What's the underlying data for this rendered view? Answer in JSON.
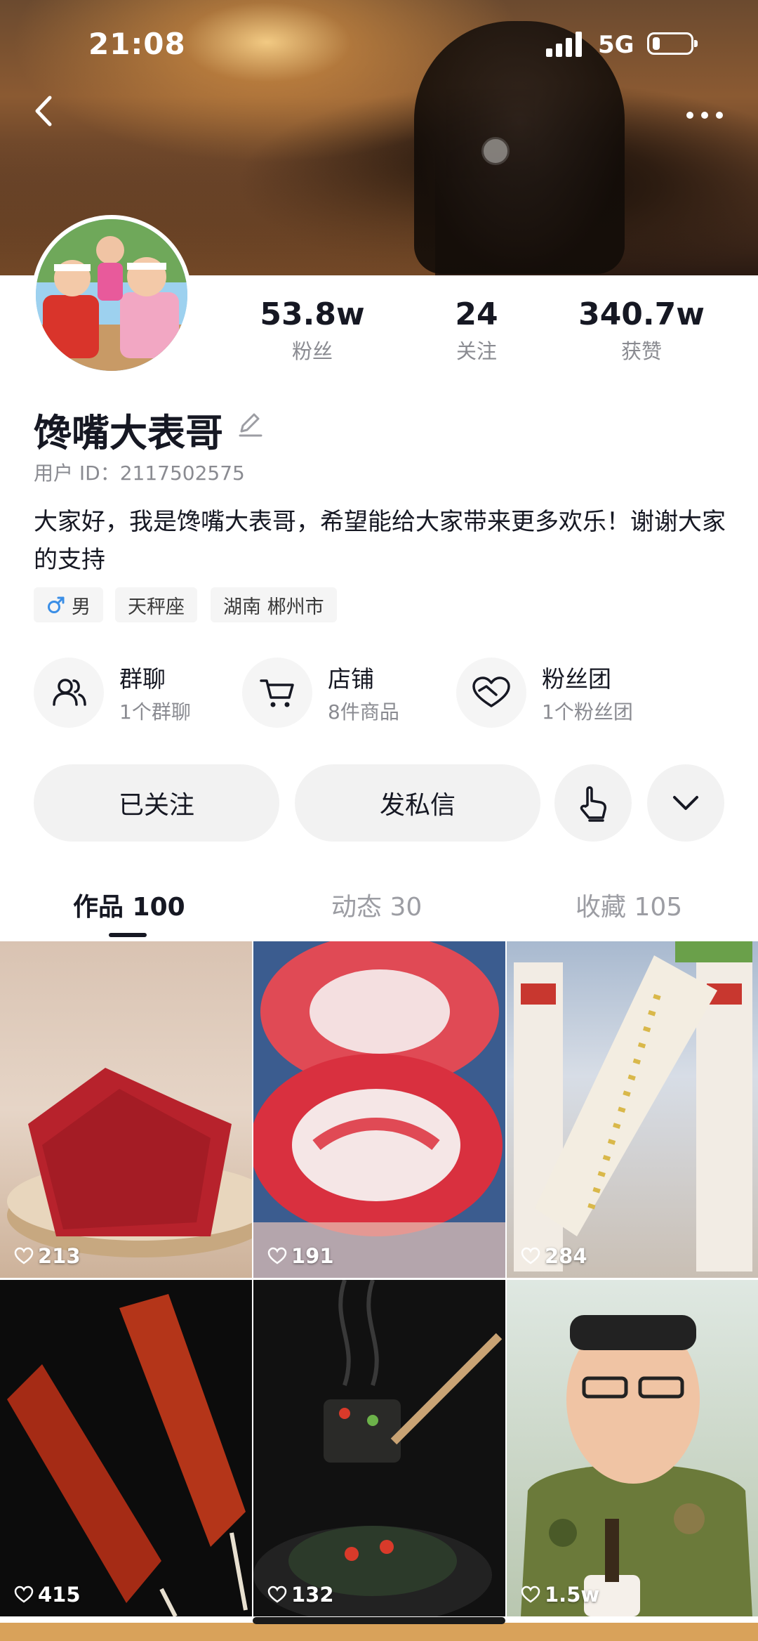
{
  "status_bar": {
    "time": "21:08",
    "network": "5G",
    "battery_level": 0.2
  },
  "header": {
    "back_icon": "chevron-left-icon",
    "more_icon": "more-horizontal-icon"
  },
  "profile": {
    "name": "馋嘴大表哥",
    "user_id": "用户 ID：2117502575",
    "bio": "大家好，我是馋嘴大表哥，希望能给大家带来更多欢乐！谢谢大家的支持",
    "stats": [
      {
        "value": "53.8w",
        "label": "粉丝"
      },
      {
        "value": "24",
        "label": "关注"
      },
      {
        "value": "340.7w",
        "label": "获赞"
      }
    ],
    "tags": [
      {
        "icon": "male-icon",
        "label": "男",
        "color": "#3a8ee6"
      },
      {
        "label": "天秤座"
      },
      {
        "label": "湖南 郴州市"
      }
    ]
  },
  "services": [
    {
      "icon": "group-chat-icon",
      "title": "群聊",
      "subtitle": "1个群聊"
    },
    {
      "icon": "shopping-cart-icon",
      "title": "店铺",
      "subtitle": "8件商品"
    },
    {
      "icon": "fan-club-heart-icon",
      "title": "粉丝团",
      "subtitle": "1个粉丝团"
    }
  ],
  "actions": {
    "followed": "已关注",
    "message": "发私信",
    "poke_icon": "tap-hand-icon",
    "expand_icon": "chevron-down-icon"
  },
  "tabs": [
    {
      "label": "作品 100",
      "active": true
    },
    {
      "label": "动态 30",
      "active": false
    },
    {
      "label": "收藏 105",
      "active": false
    }
  ],
  "videos": [
    {
      "likes": "213",
      "subject": "beef jerky"
    },
    {
      "likes": "191",
      "subject": "freeze-dried strawberry"
    },
    {
      "likes": "284",
      "subject": "osmanthus rice cake"
    },
    {
      "likes": "415",
      "subject": "spicy gluten strips"
    },
    {
      "likes": "132",
      "subject": "stinky tofu"
    },
    {
      "likes": "1.5w",
      "subject": "man eating noodles"
    }
  ],
  "colors": {
    "text": "#161823",
    "secondary": "#8a8b91",
    "chip_bg": "#f5f5f5",
    "button_bg": "#f2f2f2"
  }
}
